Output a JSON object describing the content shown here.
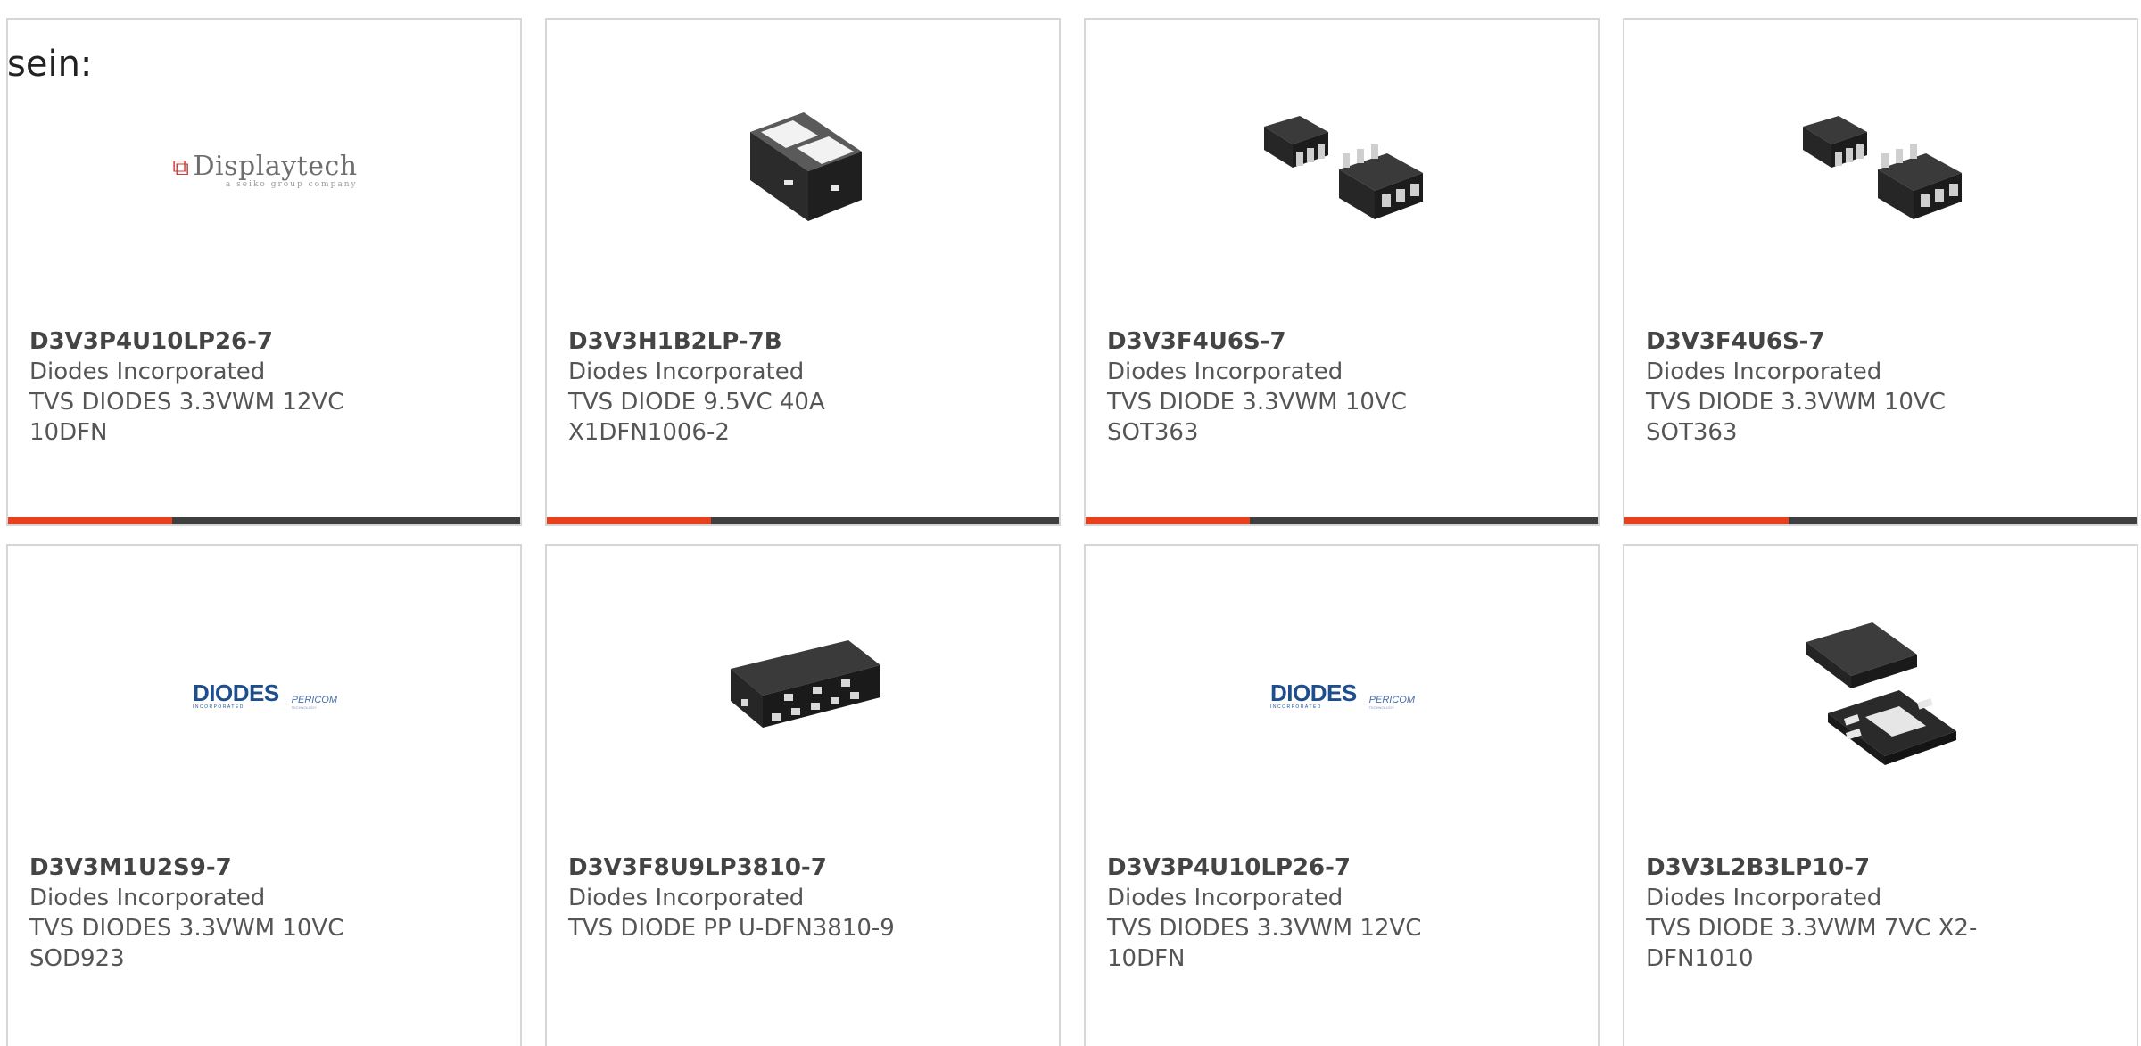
{
  "cutoff_text": "sein:",
  "accent_color": "#e8401c",
  "bar_color": "#3f3f3f",
  "accent_fraction": 0.32,
  "cards": [
    {
      "part_number": "D3V3P4U10LP26-7",
      "manufacturer": "Diodes Incorporated",
      "desc1": "TVS DIODES 3.3VWM 12VC",
      "desc2": "10DFN",
      "image": "displaytech-logo",
      "logo_text": "Displaytech"
    },
    {
      "part_number": "D3V3H1B2LP-7B",
      "manufacturer": "Diodes Incorporated",
      "desc1": "TVS DIODE 9.5VC 40A",
      "desc2": "X1DFN1006-2",
      "image": "x1dfn-chip-photo"
    },
    {
      "part_number": "D3V3F4U6S-7",
      "manufacturer": "Diodes Incorporated",
      "desc1": "TVS DIODE 3.3VWM 10VC",
      "desc2": "SOT363",
      "image": "sot363-chip-photo"
    },
    {
      "part_number": "D3V3F4U6S-7",
      "manufacturer": "Diodes Incorporated",
      "desc1": "TVS DIODE 3.3VWM 10VC",
      "desc2": "SOT363",
      "image": "sot363-chip-photo"
    },
    {
      "part_number": "D3V3M1U2S9-7",
      "manufacturer": "Diodes Incorporated",
      "desc1": "TVS DIODES 3.3VWM 10VC",
      "desc2": "SOD923",
      "image": "diodes-pericom-logo",
      "logo_text": "DIODES",
      "logo_text2": "PERICOM"
    },
    {
      "part_number": "D3V3F8U9LP3810-7",
      "manufacturer": "Diodes Incorporated",
      "desc1": "TVS DIODE PP U-DFN3810-9",
      "desc2": "",
      "image": "udfn3810-chip-photo"
    },
    {
      "part_number": "D3V3P4U10LP26-7",
      "manufacturer": "Diodes Incorporated",
      "desc1": "TVS DIODES 3.3VWM 12VC",
      "desc2": "10DFN",
      "image": "diodes-pericom-logo",
      "logo_text": "DIODES",
      "logo_text2": "PERICOM"
    },
    {
      "part_number": "D3V3L2B3LP10-7",
      "manufacturer": "Diodes Incorporated",
      "desc1": "TVS DIODE 3.3VWM 7VC X2-",
      "desc2": "DFN1010",
      "image": "x2dfn-chip-photo"
    }
  ]
}
